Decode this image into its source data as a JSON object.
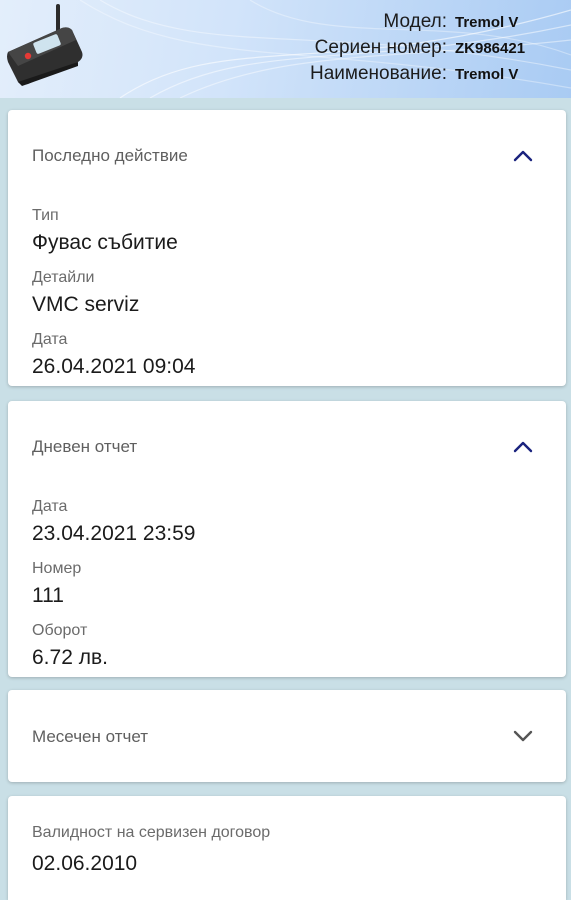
{
  "header": {
    "model_label": "Модел:",
    "model_value": "Tremol V",
    "serial_label": "Сериен номер:",
    "serial_value": "ZK986421",
    "name_label": "Наименование:",
    "name_value": "Tremol V",
    "device_image": "fiscal-device-image"
  },
  "last_action": {
    "title": "Последно действие",
    "expanded": true,
    "type_label": "Тип",
    "type_value": "Фувас събитие",
    "details_label": "Детайли",
    "details_value": "VMC serviz",
    "date_label": "Дата",
    "date_value": "26.04.2021 09:04"
  },
  "daily_report": {
    "title": "Дневен отчет",
    "expanded": true,
    "date_label": "Дата",
    "date_value": "23.04.2021 23:59",
    "number_label": "Номер",
    "number_value": "111",
    "turnover_label": "Оборот",
    "turnover_value": "6.72 лв."
  },
  "monthly_report": {
    "title": "Месечен отчет",
    "expanded": false
  },
  "service_contract": {
    "label": "Валидност на сервизен договор",
    "value": "02.06.2010"
  },
  "colors": {
    "accent": "#1a237e",
    "header_bg": "#a9cbf3",
    "page_bg": "#c9dfe6"
  }
}
